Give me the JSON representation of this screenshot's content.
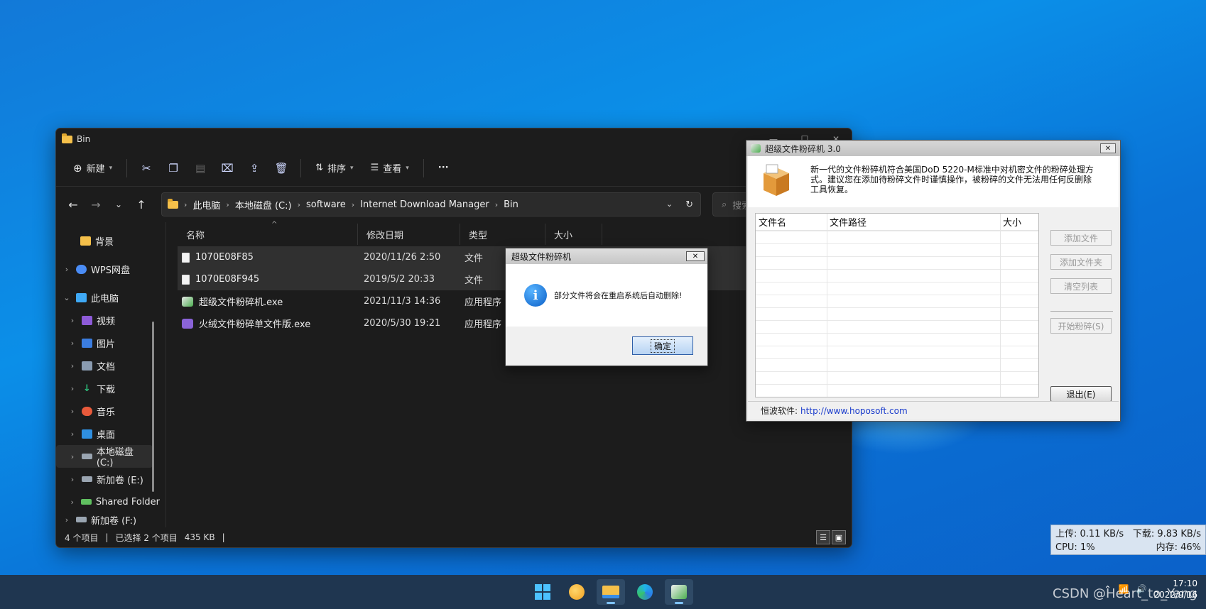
{
  "explorer": {
    "title": "Bin",
    "toolbar": {
      "new_label": "新建",
      "sort_label": "排序",
      "view_label": "查看",
      "more_label": "···"
    },
    "breadcrumb": [
      "此电脑",
      "本地磁盘 (C:)",
      "software",
      "Internet Download Manager",
      "Bin"
    ],
    "search_placeholder": "搜索",
    "sidebar": [
      {
        "label": "背景",
        "icon": "folder-icon",
        "color": "#f5c04a"
      },
      {
        "label": "WPS网盘",
        "icon": "cloud-icon",
        "color": "#4a8cf5"
      },
      {
        "label": "此电脑",
        "icon": "computer-icon",
        "color": "#3fa9f5"
      },
      {
        "label": "视频",
        "icon": "video-icon",
        "color": "#8e5bd8"
      },
      {
        "label": "图片",
        "icon": "picture-icon",
        "color": "#3b7de0"
      },
      {
        "label": "文档",
        "icon": "document-icon",
        "color": "#8a9bb0"
      },
      {
        "label": "下载",
        "icon": "download-icon",
        "color": "#2ec27e"
      },
      {
        "label": "音乐",
        "icon": "music-icon",
        "color": "#e85a3b"
      },
      {
        "label": "桌面",
        "icon": "desktop-icon",
        "color": "#2f8fe0"
      },
      {
        "label": "本地磁盘 (C:)",
        "icon": "drive-icon",
        "color": "#9aa5b1"
      },
      {
        "label": "新加卷 (E:)",
        "icon": "drive-icon",
        "color": "#9aa5b1"
      },
      {
        "label": "Shared Folder",
        "icon": "network-drive-icon",
        "color": "#5fbf5f"
      },
      {
        "label": "新加卷 (F:)",
        "icon": "drive-icon",
        "color": "#9aa5b1"
      }
    ],
    "columns": [
      "名称",
      "修改日期",
      "类型",
      "大小"
    ],
    "files": [
      {
        "name": "1070E08F85",
        "date": "2020/11/26 2:50",
        "type": "文件",
        "icon": "file-icon"
      },
      {
        "name": "1070E08F945",
        "date": "2019/5/2 20:33",
        "type": "文件",
        "icon": "file-icon"
      },
      {
        "name": "超级文件粉碎机.exe",
        "date": "2021/11/3 14:36",
        "type": "应用程序",
        "icon": "shredder-app-icon"
      },
      {
        "name": "火绒文件粉碎单文件版.exe",
        "date": "2020/5/30 19:21",
        "type": "应用程序",
        "icon": "huorong-app-icon"
      }
    ],
    "status": {
      "count": "4 个项目",
      "selected": "已选择 2 个项目",
      "size": "435 KB"
    }
  },
  "shredder": {
    "title": "超级文件粉碎机  3.0",
    "description": "新一代的文件粉碎机符合美国DoD 5220-M标准中对机密文件的粉碎处理方式。建议您在添加待粉碎文件时谨慎操作，被粉碎的文件无法用任何反删除工具恢复。",
    "columns": [
      "文件名",
      "文件路径",
      "大小"
    ],
    "buttons": {
      "add_file": "添加文件",
      "add_folder": "添加文件夹",
      "clear_list": "清空列表",
      "start": "开始粉碎(S)",
      "exit": "退出(E)"
    },
    "footer_label": "恒波软件:",
    "footer_link": "http://www.hoposoft.com"
  },
  "messagebox": {
    "title": "超级文件粉碎机",
    "message": "部分文件将会在重启系统后自动删除!",
    "ok_label": "确定"
  },
  "netmon": {
    "upload": "上传: 0.11 KB/s",
    "download": "下载: 9.83 KB/s",
    "cpu": "CPU: 1%",
    "memory": "内存: 46%"
  },
  "taskbar": {
    "apps": [
      "start-icon",
      "weather-icon",
      "file-explorer-icon",
      "edge-icon",
      "shredder-app-icon"
    ],
    "tray_time": "17:10",
    "tray_date": "2022/9/16"
  },
  "watermark": "CSDN @Heart_to_Yang"
}
